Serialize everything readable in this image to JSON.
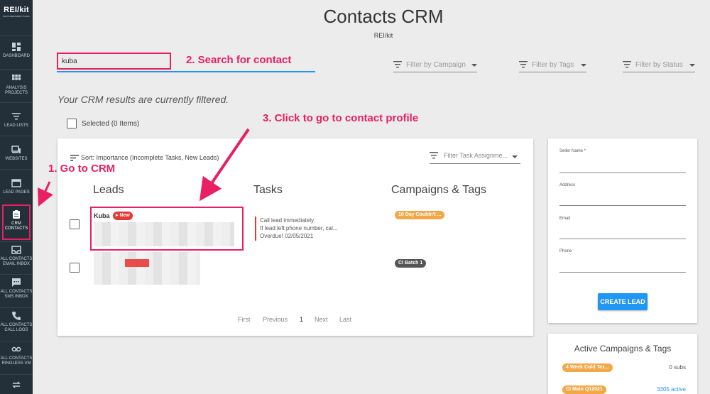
{
  "sidebar": {
    "logo_line1": "REI/kit",
    "logo_line2": "PRO INVESTMENT TOOLS",
    "items": [
      {
        "label": "DASHBOARD"
      },
      {
        "label": "ANALYSIS PROJECTS"
      },
      {
        "label": "LEAD LISTS"
      },
      {
        "label": "WEBSITES"
      },
      {
        "label": "LEAD PAGES"
      },
      {
        "label": "CRM CONTACTS"
      },
      {
        "label": "ALL CONTACTS EMAIL INBOX"
      },
      {
        "label": "ALL CONTACTS SMS INBOX"
      },
      {
        "label": "ALL CONTACTS CALL LOGS"
      },
      {
        "label": "ALL CONTACTS RINGLESS VM"
      }
    ]
  },
  "header": {
    "title": "Contacts CRM",
    "subtitle": "REI/kit"
  },
  "search": {
    "value": "kuba",
    "placeholder": ""
  },
  "filters": {
    "campaign": "Filter by Campaign",
    "tags": "Filter by Tags",
    "status": "Filter by Status"
  },
  "filtered_note": "Your CRM results are currently filtered.",
  "selected_label": "Selected (0 Items)",
  "leads_card": {
    "sort_label": "Sort: Importance (Incomplete Tasks, New Leads)",
    "task_filter": "Filter Task Assignme...",
    "columns": {
      "leads": "Leads",
      "tasks": "Tasks",
      "campaigns": "Campaigns & Tags"
    },
    "rows": [
      {
        "name": "Kuba",
        "badge": "New",
        "tasks": [
          "Call lead immediately",
          "If lead left phone number, cal...",
          "Overdue! 02/05/2021"
        ],
        "tag": "10 Day Couldn't ...",
        "tag_color": "#f0a848"
      },
      {
        "name": "",
        "badge": "",
        "tasks": [],
        "tag": "CI Batch 1",
        "tag_color": "#555555"
      }
    ],
    "pagination": {
      "first": "First",
      "previous": "Previous",
      "current": "1",
      "next": "Next",
      "last": "Last"
    }
  },
  "new_lead_form": {
    "fields": {
      "seller_name": "Seller Name *",
      "address": "Address",
      "email": "Email",
      "phone": "Phone"
    },
    "button": "CREATE LEAD"
  },
  "active_campaigns": {
    "title": "Active Campaigns & Tags",
    "items": [
      {
        "tag": "4 Week Cold Tex...",
        "count": "0 subs",
        "tag_color": "#f0a848"
      },
      {
        "tag": "CI Main Q12021",
        "count": "3305 active",
        "tag_color": "#f0a848"
      }
    ]
  },
  "annotations": {
    "step1": "1. Go to CRM",
    "step2": "2. Search for contact",
    "step3": "3. Click to go to contact profile"
  },
  "colors": {
    "accent_pink": "#e91e63",
    "primary_blue": "#2196f3",
    "sidebar_bg": "#23303a"
  }
}
